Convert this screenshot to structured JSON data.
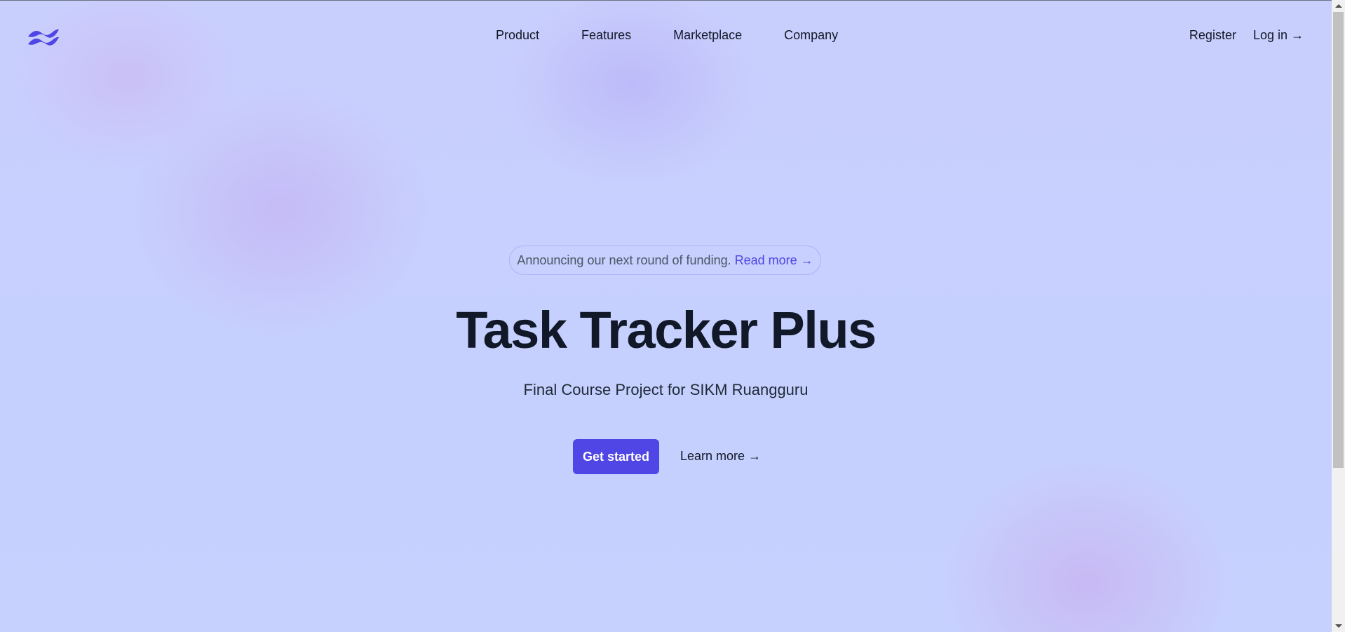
{
  "header": {
    "logo_icon": "tailwind-wave-icon",
    "nav": [
      {
        "label": "Product"
      },
      {
        "label": "Features"
      },
      {
        "label": "Marketplace"
      },
      {
        "label": "Company"
      }
    ],
    "register_label": "Register",
    "login_label": "Log in →"
  },
  "hero": {
    "announcement_text": "Announcing our next round of funding.",
    "read_more_label": "Read more →",
    "title": "Task Tracker Plus",
    "subtitle": "Final Course Project for SIKM Ruangguru",
    "get_started_label": "Get started",
    "learn_more_label": "Learn more →"
  },
  "colors": {
    "accent": "#4f46e5",
    "background": "#c7d2fe",
    "text": "#111827"
  }
}
